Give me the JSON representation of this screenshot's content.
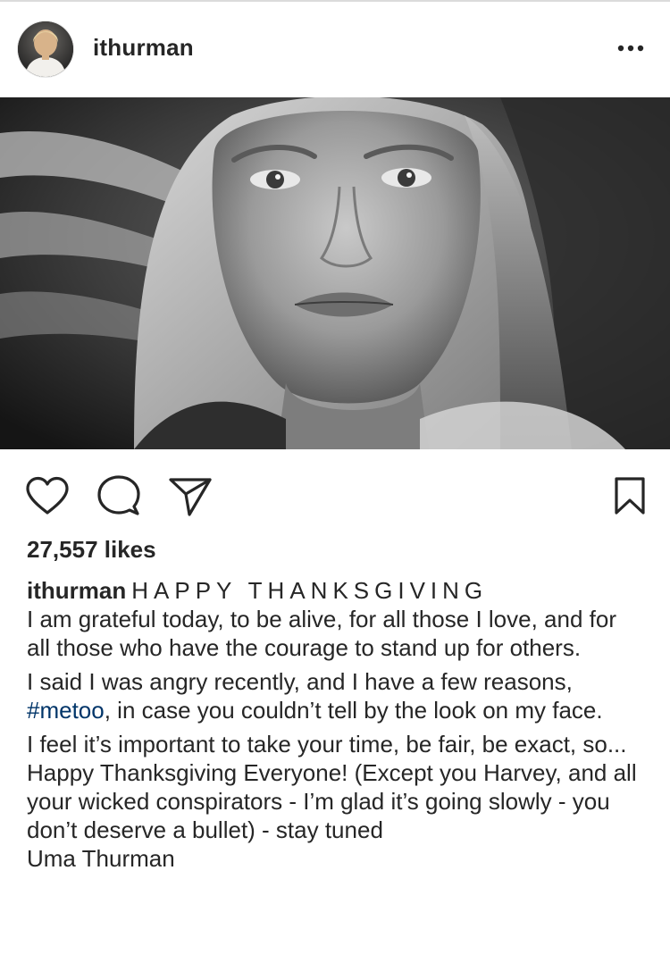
{
  "post": {
    "username": "ithurman",
    "more_icon": "ellipsis-icon",
    "image_alt": "black-and-white close-up portrait",
    "actions": {
      "like_icon": "heart-icon",
      "comment_icon": "comment-bubble-icon",
      "share_icon": "paper-plane-icon",
      "save_icon": "bookmark-icon"
    },
    "likes": "27,557 likes",
    "caption": {
      "username": "ithurman",
      "heading": "HAPPY THANKSGIVING",
      "p1": "I am grateful today, to be alive, for all those I love, and for all those who have the courage to stand up for others.",
      "p2_before": "I said I was angry recently, and I have a few reasons, ",
      "hashtag": "#metoo",
      "p2_after": ", in case you couldn’t tell by the look on my face.",
      "p3": "I feel it’s important to take your time, be fair, be exact, so... Happy Thanksgiving Everyone! (Except you Harvey, and all your wicked conspirators - I’m glad it’s going slowly - you don’t deserve a bullet) - stay tuned",
      "signature": "Uma Thurman"
    }
  },
  "colors": {
    "text": "#262626",
    "hashtag": "#003569",
    "divider": "#dbdbdb"
  }
}
